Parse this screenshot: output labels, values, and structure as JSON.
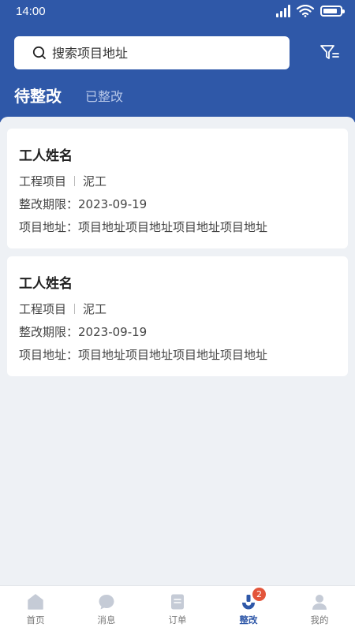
{
  "status_bar": {
    "time": "14:00"
  },
  "search": {
    "placeholder": "搜索项目地址"
  },
  "tabs": [
    {
      "label": "待整改"
    },
    {
      "label": "已整改"
    }
  ],
  "cards": [
    {
      "worker_name": "工人姓名",
      "project_label": "工程项目",
      "trade": "泥工",
      "deadline_label": "整改期限：",
      "deadline": "2023-09-19",
      "address_label": "项目地址：",
      "address": "项目地址项目地址项目地址项目地址"
    },
    {
      "worker_name": "工人姓名",
      "project_label": "工程项目",
      "trade": "泥工",
      "deadline_label": "整改期限：",
      "deadline": "2023-09-19",
      "address_label": "项目地址：",
      "address": "项目地址项目地址项目地址项目地址"
    }
  ],
  "tabbar": {
    "items": [
      {
        "label": "首页",
        "icon": "home-icon"
      },
      {
        "label": "消息",
        "icon": "message-icon"
      },
      {
        "label": "订单",
        "icon": "order-icon"
      },
      {
        "label": "整改",
        "icon": "rectify-icon",
        "badge": "2",
        "active": true
      },
      {
        "label": "我的",
        "icon": "profile-icon"
      }
    ]
  },
  "colors": {
    "primary": "#2f58a8",
    "background": "#eef1f5",
    "badge": "#e3553b",
    "tab_inactive": "#b7c7e8"
  }
}
